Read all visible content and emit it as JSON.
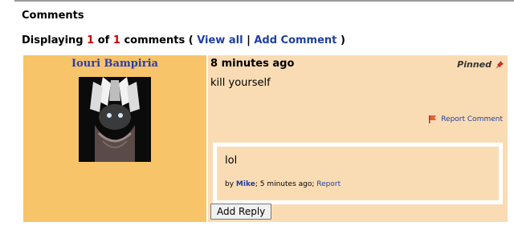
{
  "section_title": "Comments",
  "summary": {
    "prefix": "Displaying",
    "shown": "1",
    "of": "of",
    "total": "1",
    "suffix": "comments (",
    "view_all": "View all",
    "separator": "|",
    "add_comment": "Add Comment",
    "close": ")"
  },
  "comment": {
    "username": "Iouri Bampiria",
    "time": "8 minutes ago",
    "pinned_label": "Pinned",
    "text": "kill yourself",
    "report_label": "Report Comment",
    "reply": {
      "text": "lol",
      "by": "by",
      "author": "Mike",
      "sep1": ";",
      "time": "5 minutes ago",
      "sep2": ";",
      "report": "Report"
    },
    "add_reply_label": "Add Reply"
  },
  "colors": {
    "left_bg": "#f7c46a",
    "right_bg": "#fadcb4",
    "link": "#1f3fa0",
    "count": "#cc0000"
  },
  "icons": {
    "pinned": "pushpin-icon",
    "report": "flag-icon"
  }
}
